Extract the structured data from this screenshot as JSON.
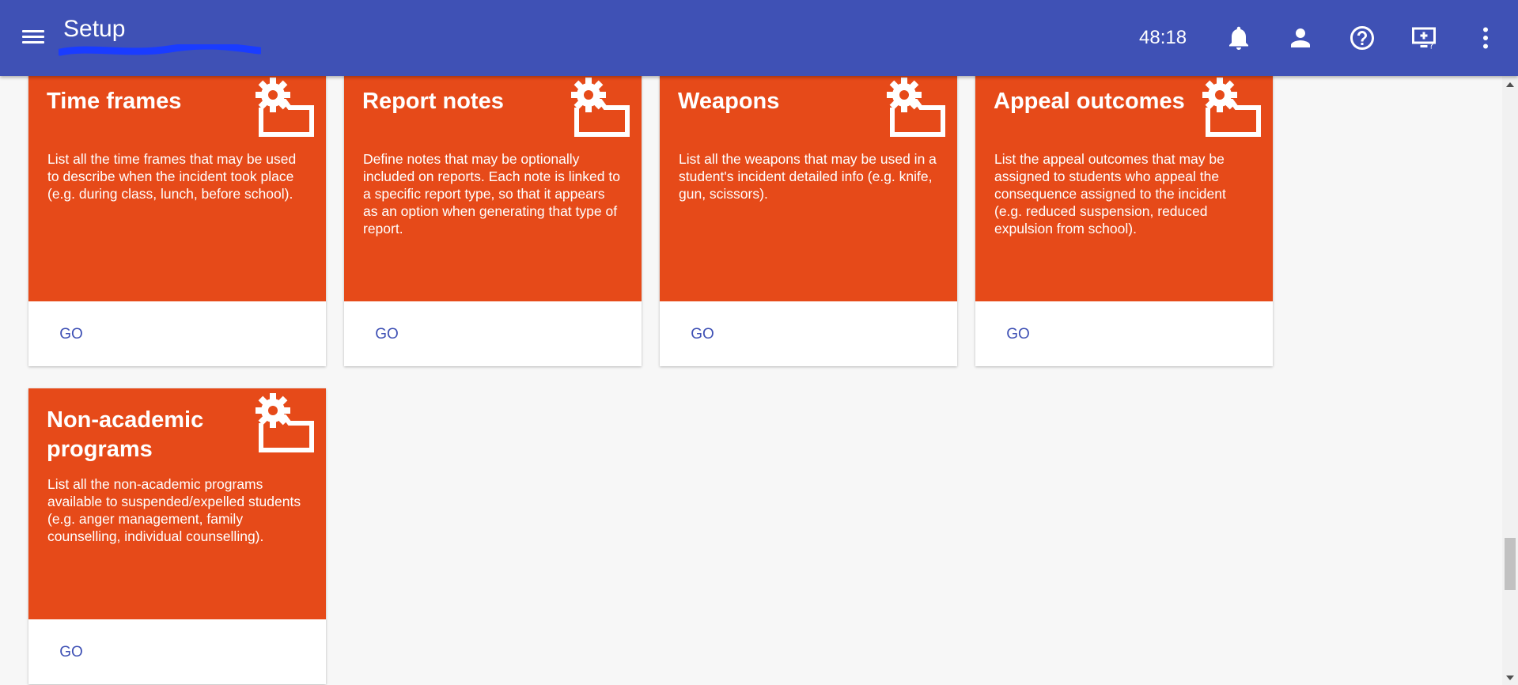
{
  "header": {
    "title": "Setup",
    "timer": "48:18",
    "icons": [
      "menu-icon",
      "bell-icon",
      "person-icon",
      "help-icon",
      "screen-share-icon",
      "more-vert-icon"
    ]
  },
  "colors": {
    "header": "#3f51b5",
    "card": "#e64a19",
    "link": "#3f51b5",
    "redaction": "#1a3cff"
  },
  "cards": [
    {
      "title": "Time frames",
      "description": "List all the time frames that may be used to describe when the incident took place (e.g. during class, lunch, before school).",
      "action": "GO",
      "icon": "settings-folder-icon"
    },
    {
      "title": "Report notes",
      "description": "Define notes that may be optionally included on reports. Each note is linked to a specific report type, so that it appears as an option when generating that type of report.",
      "action": "GO",
      "icon": "settings-folder-icon"
    },
    {
      "title": "Weapons",
      "description": "List all the weapons that may be used in a student's incident detailed info (e.g. knife, gun, scissors).",
      "action": "GO",
      "icon": "settings-folder-icon"
    },
    {
      "title": "Appeal outcomes",
      "description": "List the appeal outcomes that may be assigned to students who appeal the consequence assigned to the incident (e.g. reduced suspension, reduced expulsion from school).",
      "action": "GO",
      "icon": "settings-folder-icon"
    },
    {
      "title": "Non-academic programs",
      "description": "List all the non-academic programs available to suspended/expelled students (e.g. anger management, family counselling, individual counselling).",
      "action": "GO",
      "icon": "settings-folder-icon"
    }
  ]
}
